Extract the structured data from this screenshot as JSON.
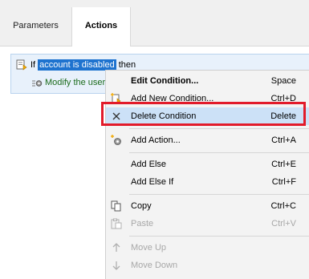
{
  "tabs": [
    {
      "label": "Parameters",
      "active": false
    },
    {
      "label": "Actions",
      "active": true
    }
  ],
  "editor": {
    "condition": {
      "prefix": "If",
      "selected_text": "account is disabled",
      "suffix": "then"
    },
    "action_text": "Modify the user:"
  },
  "menu": {
    "items": [
      {
        "label": "Edit Condition...",
        "shortcut": "Space",
        "icon": "",
        "bold": true,
        "enabled": true
      },
      {
        "label": "Add New Condition...",
        "shortcut": "Ctrl+D",
        "icon": "add-condition-icon",
        "enabled": true
      },
      {
        "label": "Delete Condition",
        "shortcut": "Delete",
        "icon": "delete-x-icon",
        "enabled": true,
        "highlighted": true
      },
      {
        "label": "Add Action...",
        "shortcut": "Ctrl+A",
        "icon": "add-action-gear-icon",
        "enabled": true
      },
      {
        "label": "Add Else",
        "shortcut": "Ctrl+E",
        "icon": "",
        "enabled": true
      },
      {
        "label": "Add Else If",
        "shortcut": "Ctrl+F",
        "icon": "",
        "enabled": true
      },
      {
        "label": "Copy",
        "shortcut": "Ctrl+C",
        "icon": "copy-icon",
        "enabled": true
      },
      {
        "label": "Paste",
        "shortcut": "Ctrl+V",
        "icon": "paste-icon",
        "enabled": false
      },
      {
        "label": "Move Up",
        "shortcut": "",
        "icon": "arrow-up-icon",
        "enabled": false
      },
      {
        "label": "Move Down",
        "shortcut": "",
        "icon": "arrow-down-icon",
        "enabled": false
      }
    ]
  },
  "colors": {
    "selection": "#1e73cf",
    "highlight": "#cce1f7",
    "callout_border": "#e21b2a",
    "action_text": "#1b6b1b"
  }
}
